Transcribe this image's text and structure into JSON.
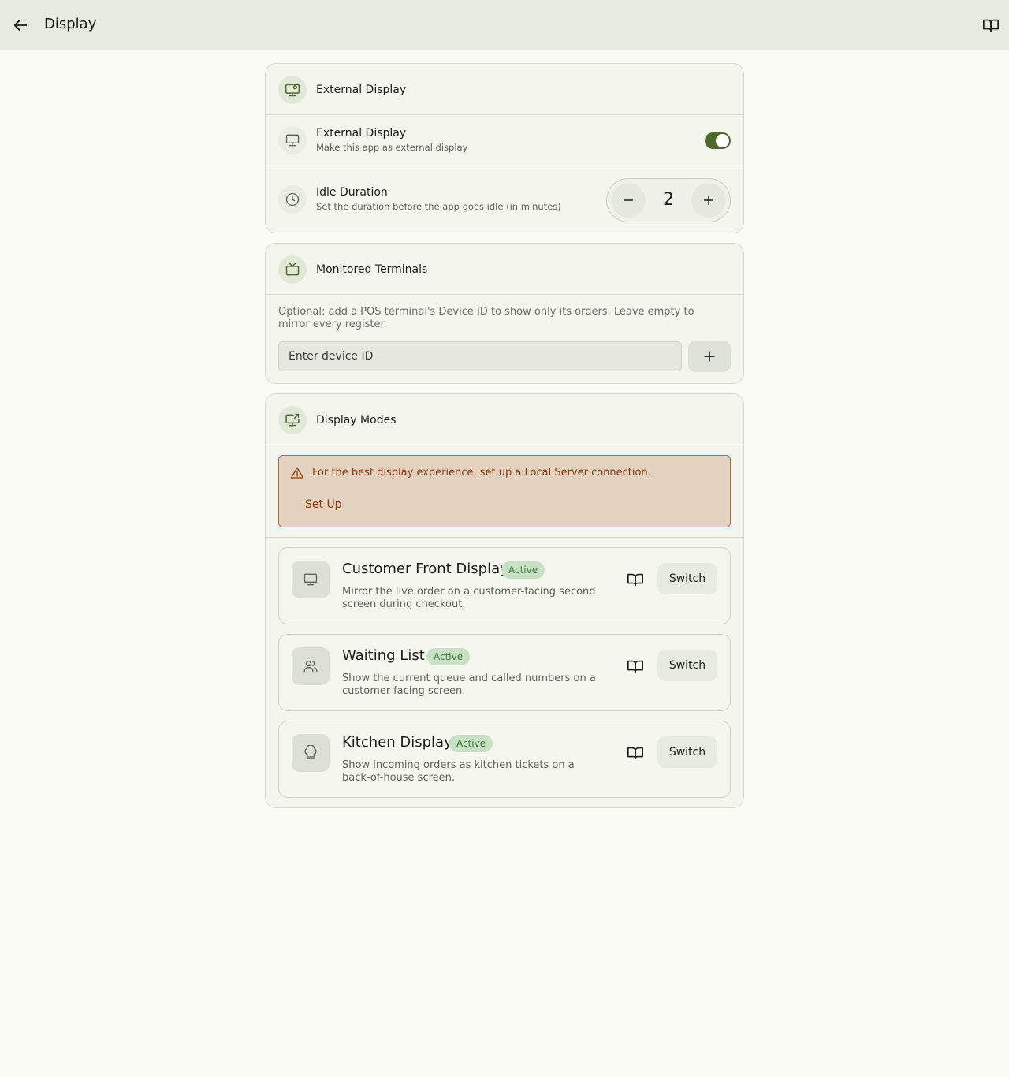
{
  "header": {
    "title": "Display",
    "back_icon": "arrow-left-icon",
    "docs_icon": "book-icon"
  },
  "external_display": {
    "section_title": "External Display",
    "toggle_row": {
      "title": "External Display",
      "subtitle": "Make this app as external display",
      "enabled": true
    },
    "idle_row": {
      "title": "Idle Duration",
      "subtitle": "Set the duration before the app goes idle (in minutes)",
      "value": "2"
    }
  },
  "monitored_terminals": {
    "section_title": "Monitored Terminals",
    "helper": "Optional: add a POS terminal's Device ID to show only its orders. Leave empty to mirror every register.",
    "input_placeholder": "Enter device ID"
  },
  "display_modes": {
    "section_title": "Display Modes",
    "warning": {
      "text": "For the best display experience, set up a Local Server connection.",
      "action": "Set Up"
    },
    "modes": [
      {
        "title": "Customer Front Display",
        "badge": "Active",
        "description": "Mirror the live order on a customer-facing second screen during checkout.",
        "button": "Switch",
        "icon": "monitor-icon"
      },
      {
        "title": "Waiting List",
        "badge": "Active",
        "description": "Show the current queue and called numbers on a customer-facing screen.",
        "button": "Switch",
        "icon": "users-icon"
      },
      {
        "title": "Kitchen Display",
        "badge": "Active",
        "description": "Show incoming orders as kitchen tickets on a back-of-house screen.",
        "button": "Switch",
        "icon": "chef-hat-icon"
      }
    ]
  },
  "colors": {
    "accent": "#4d6a2c",
    "warning_border": "#b06a32",
    "warning_text": "#8a3c0e",
    "badge_bg": "#c8e0c4",
    "badge_text": "#3c7a3c"
  }
}
